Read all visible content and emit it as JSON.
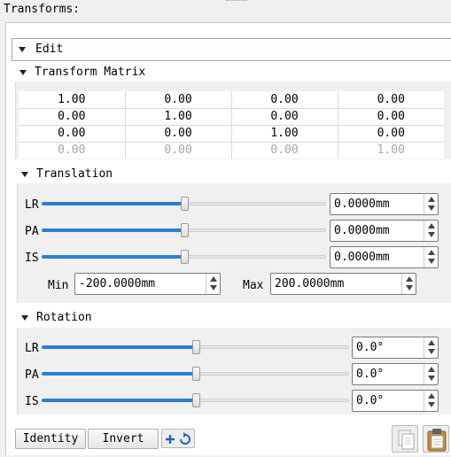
{
  "title": "Transforms:",
  "edit_section": {
    "label": "Edit"
  },
  "matrix_section": {
    "label": "Transform Matrix",
    "rows": [
      [
        "1.00",
        "0.00",
        "0.00",
        "0.00"
      ],
      [
        "0.00",
        "1.00",
        "0.00",
        "0.00"
      ],
      [
        "0.00",
        "0.00",
        "1.00",
        "0.00"
      ],
      [
        "0.00",
        "0.00",
        "0.00",
        "1.00"
      ]
    ]
  },
  "translation_section": {
    "label": "Translation",
    "sliders": [
      {
        "axis": "LR",
        "value": "0.0000mm",
        "level": 0.5
      },
      {
        "axis": "PA",
        "value": "0.0000mm",
        "level": 0.5
      },
      {
        "axis": "IS",
        "value": "0.0000mm",
        "level": 0.5
      }
    ],
    "min_label": "Min",
    "min_value": "-200.0000mm",
    "max_label": "Max",
    "max_value": "200.0000mm"
  },
  "rotation_section": {
    "label": "Rotation",
    "sliders": [
      {
        "axis": "LR",
        "value": "0.0°",
        "level": 0.5
      },
      {
        "axis": "PA",
        "value": "0.0°",
        "level": 0.5
      },
      {
        "axis": "IS",
        "value": "0.0°",
        "level": 0.5
      }
    ]
  },
  "buttons": {
    "identity": "Identity",
    "invert": "Invert",
    "split_icon": "add-refresh-icon",
    "copy_icon": "copy-icon",
    "paste_icon": "paste-icon"
  },
  "colors": {
    "slider_fill": "#2a7fd4"
  }
}
